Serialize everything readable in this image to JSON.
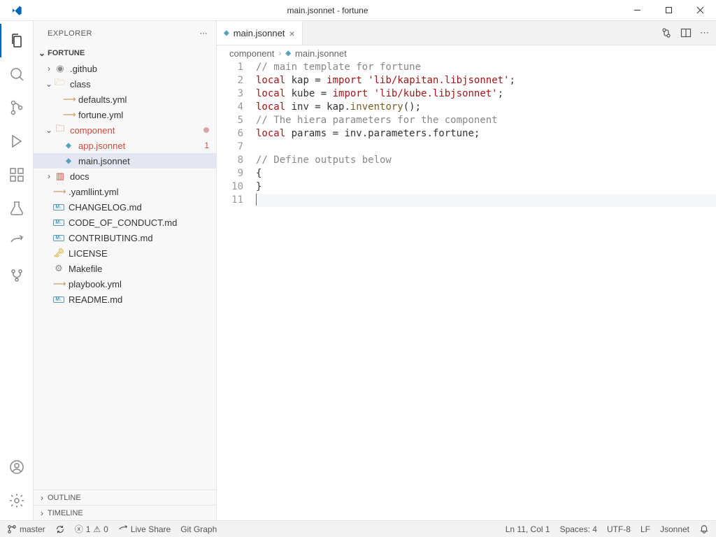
{
  "window": {
    "title": "main.jsonnet - fortune"
  },
  "explorer": {
    "title": "EXPLORER",
    "project": "FORTUNE",
    "outline": "OUTLINE",
    "timeline": "TIMELINE",
    "tree": {
      "github": ".github",
      "class": "class",
      "defaults_yml": "defaults.yml",
      "fortune_yml": "fortune.yml",
      "component": "component",
      "app_jsonnet": "app.jsonnet",
      "app_badge": "1",
      "main_jsonnet": "main.jsonnet",
      "docs": "docs",
      "yamllint": ".yamllint.yml",
      "changelog": "CHANGELOG.md",
      "coc": "CODE_OF_CONDUCT.md",
      "contributing": "CONTRIBUTING.md",
      "license": "LICENSE",
      "makefile": "Makefile",
      "playbook": "playbook.yml",
      "readme": "README.md"
    }
  },
  "tab": {
    "label": "main.jsonnet"
  },
  "breadcrumb": {
    "seg1": "component",
    "seg2": "main.jsonnet"
  },
  "code": {
    "lines": [
      {
        "n": 1,
        "tokens": [
          {
            "c": "",
            "t": ""
          },
          {
            "c": "// main template for fortune",
            "t": "comment"
          }
        ]
      },
      {
        "n": 2,
        "tokens": [
          {
            "c": "local",
            "t": "keyword"
          },
          {
            "c": " kap = ",
            "t": ""
          },
          {
            "c": "import",
            "t": "keyword"
          },
          {
            "c": " ",
            "t": ""
          },
          {
            "c": "'lib/kapitan.libjsonnet'",
            "t": "string"
          },
          {
            "c": ";",
            "t": ""
          }
        ]
      },
      {
        "n": 3,
        "tokens": [
          {
            "c": "local",
            "t": "keyword"
          },
          {
            "c": " kube = ",
            "t": ""
          },
          {
            "c": "import",
            "t": "keyword"
          },
          {
            "c": " ",
            "t": ""
          },
          {
            "c": "'lib/kube.libjsonnet'",
            "t": "string"
          },
          {
            "c": ";",
            "t": ""
          }
        ]
      },
      {
        "n": 4,
        "tokens": [
          {
            "c": "local",
            "t": "keyword"
          },
          {
            "c": " inv = kap.",
            "t": ""
          },
          {
            "c": "inventory",
            "t": "func"
          },
          {
            "c": "();",
            "t": ""
          }
        ]
      },
      {
        "n": 5,
        "tokens": [
          {
            "c": "// The hiera parameters for the component",
            "t": "comment"
          }
        ]
      },
      {
        "n": 6,
        "tokens": [
          {
            "c": "local",
            "t": "keyword"
          },
          {
            "c": " params = inv.parameters.fortune;",
            "t": ""
          }
        ]
      },
      {
        "n": 7,
        "tokens": []
      },
      {
        "n": 8,
        "tokens": [
          {
            "c": "// Define outputs below",
            "t": "comment"
          }
        ]
      },
      {
        "n": 9,
        "tokens": [
          {
            "c": "{",
            "t": ""
          }
        ]
      },
      {
        "n": 10,
        "tokens": [
          {
            "c": "}",
            "t": ""
          }
        ]
      },
      {
        "n": 11,
        "tokens": [],
        "cursor": true,
        "hl": true
      }
    ]
  },
  "status": {
    "branch": "master",
    "errors": "1",
    "warnings": "0",
    "liveshare": "Live Share",
    "gitgraph": "Git Graph",
    "position": "Ln 11, Col 1",
    "spaces": "Spaces: 4",
    "encoding": "UTF-8",
    "eol": "LF",
    "lang": "Jsonnet"
  }
}
